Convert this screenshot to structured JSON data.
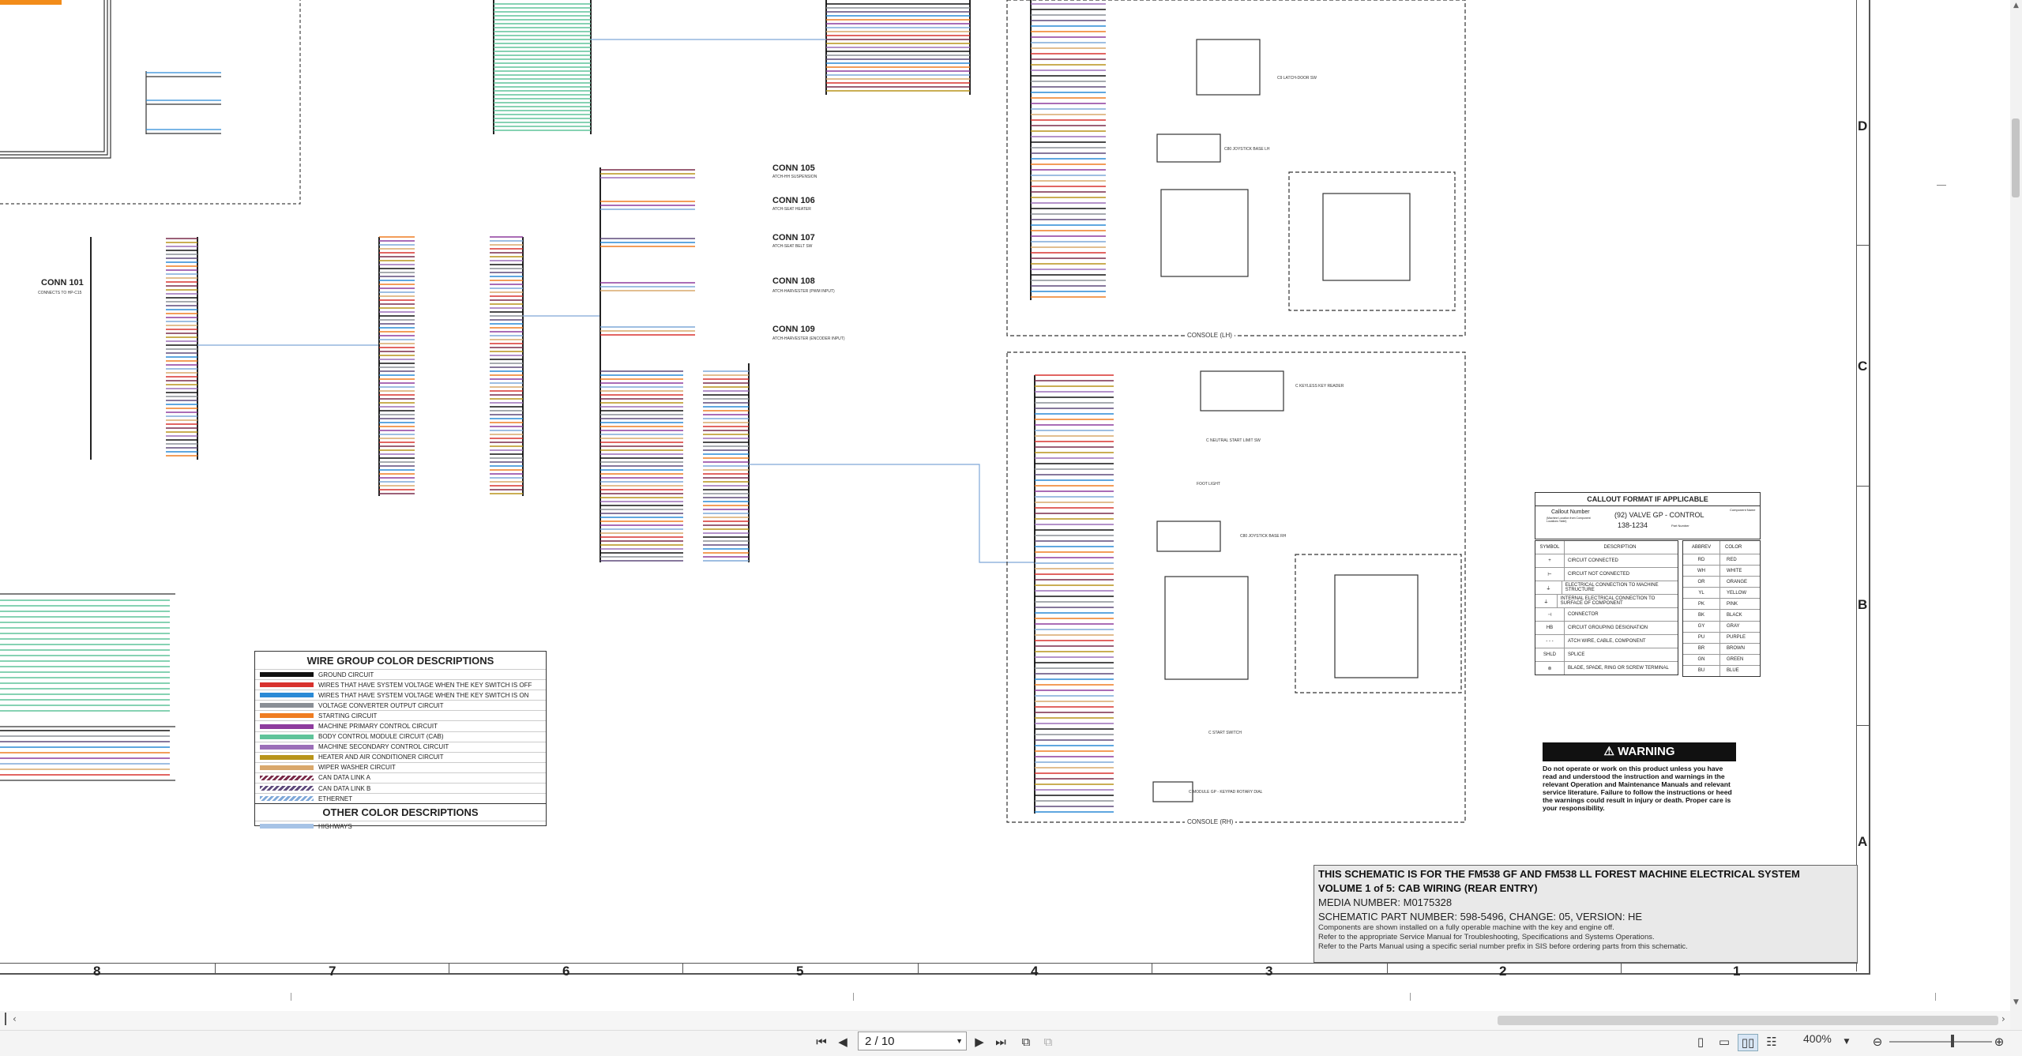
{
  "sheet": {
    "zone_letters": [
      "D",
      "C",
      "B",
      "A"
    ],
    "zone_numbers": [
      "8",
      "7",
      "6",
      "5",
      "4",
      "3",
      "2",
      "1"
    ],
    "connectors": [
      {
        "name": "CONN 101",
        "sub": "CONNECTS TO HP-C15"
      },
      {
        "name": "CONN 105",
        "sub": "ATCH-HH SUSPENSION"
      },
      {
        "name": "CONN 106",
        "sub": "ATCH-SEAT HEATER"
      },
      {
        "name": "CONN 107",
        "sub": "ATCH-SEAT BELT SW"
      },
      {
        "name": "CONN 108",
        "sub": "ATCH-HARVESTER (PWM INPUT)"
      },
      {
        "name": "CONN 109",
        "sub": "ATCH-HARVESTER (ENCODER INPUT)"
      }
    ],
    "console_lh": "CONSOLE (LH)",
    "console_rh": "CONSOLE (RH)",
    "components": [
      "C9 LATCH-DOOR SW",
      "C80 JOYSTICK BASE LH",
      "C NEUTRAL START LIMIT SW",
      "FOOT LIGHT",
      "C80 JOYSTICK BASE RH",
      "C START SWITCH",
      "C MODULE GP - KEYPAD ROTARY DIAL",
      "C KEYLESS KEY READER"
    ]
  },
  "wire_legend": {
    "title": "WIRE GROUP COLOR DESCRIPTIONS",
    "rows": [
      {
        "color": "#111111",
        "label": "GROUND CIRCUIT"
      },
      {
        "color": "#d8322e",
        "label": "WIRES THAT HAVE SYSTEM VOLTAGE WHEN THE KEY SWITCH IS OFF"
      },
      {
        "color": "#2a8ad6",
        "label": "WIRES THAT HAVE SYSTEM VOLTAGE WHEN THE KEY SWITCH IS ON"
      },
      {
        "color": "#8a8f96",
        "label": "VOLTAGE CONVERTER OUTPUT CIRCUIT"
      },
      {
        "color": "#ef7d22",
        "label": "STARTING CIRCUIT"
      },
      {
        "color": "#8e3c9e",
        "label": "MACHINE PRIMARY CONTROL CIRCUIT"
      },
      {
        "color": "#5fc39a",
        "label": "BODY CONTROL MODULE CIRCUIT (CAB)"
      },
      {
        "color": "#9b6fb8",
        "label": "MACHINE SECONDARY CONTROL CIRCUIT"
      },
      {
        "color": "#b8941a",
        "label": "HEATER AND AIR CONDITIONER CIRCUIT"
      },
      {
        "color": "#d9a86c",
        "label": "WIPER WASHER CIRCUIT"
      },
      {
        "color": "#7a2b4a",
        "label": "CAN DATA LINK A"
      },
      {
        "color": "#5e4a7c",
        "label": "CAN DATA LINK B"
      },
      {
        "color": "#7fa8d8",
        "label": "ETHERNET"
      }
    ],
    "other_title": "OTHER COLOR DESCRIPTIONS",
    "other_rows": [
      {
        "color": "#a6c3e6",
        "label": "HIGHWAYS"
      }
    ]
  },
  "callout": {
    "title": "CALLOUT FORMAT IF APPLICABLE",
    "line1": "Callout Number",
    "line1b": "(Machine Location from Component Locations Table)",
    "example": "(92) VALVE GP - CONTROL",
    "part": "138-1234",
    "part_label": "Part Number",
    "name_label": "Component Name"
  },
  "symbols": {
    "headers": [
      "SYMBOL",
      "DESCRIPTION"
    ],
    "rows": [
      {
        "sym": "+",
        "desc": "CIRCUIT CONNECTED"
      },
      {
        "sym": "⊢",
        "desc": "CIRCUIT NOT CONNECTED"
      },
      {
        "sym": "⏚",
        "desc": "ELECTRICAL CONNECTION TO MACHINE STRUCTURE"
      },
      {
        "sym": "⏚",
        "desc": "INTERNAL ELECTRICAL CONNECTION TO SURFACE OF COMPONENT"
      },
      {
        "sym": "⊣",
        "desc": "CONNECTOR"
      },
      {
        "sym": "HB",
        "desc": "CIRCUIT GROUPING DESIGNATION"
      },
      {
        "sym": "- - -",
        "desc": "ATCH WIRE, CABLE, COMPONENT"
      },
      {
        "sym": "SHLD",
        "desc": "SPLICE"
      },
      {
        "sym": "⊚",
        "desc": "BLADE, SPADE, RING OR SCREW TERMINAL"
      }
    ]
  },
  "abbrev": {
    "headers": [
      "ABBREV",
      "COLOR"
    ],
    "rows": [
      {
        "a": "RD",
        "c": "RED"
      },
      {
        "a": "WH",
        "c": "WHITE"
      },
      {
        "a": "OR",
        "c": "ORANGE"
      },
      {
        "a": "YL",
        "c": "YELLOW"
      },
      {
        "a": "PK",
        "c": "PINK"
      },
      {
        "a": "BK",
        "c": "BLACK"
      },
      {
        "a": "GY",
        "c": "GRAY"
      },
      {
        "a": "PU",
        "c": "PURPLE"
      },
      {
        "a": "BR",
        "c": "BROWN"
      },
      {
        "a": "GN",
        "c": "GREEN"
      },
      {
        "a": "BU",
        "c": "BLUE"
      }
    ]
  },
  "warning": {
    "title": "WARNING",
    "text": "Do not operate or work on this product unless you have read and understood the instruction and warnings in the relevant Operation and Maintenance Manuals and relevant service literature. Failure to follow the instructions or heed the warnings could result in injury or death. Proper care is your responsibility."
  },
  "titleblock": {
    "line1": "THIS SCHEMATIC IS FOR THE FM538 GF AND FM538 LL FOREST MACHINE ELECTRICAL SYSTEM",
    "line2": "VOLUME 1 of 5: CAB WIRING (REAR ENTRY)",
    "line3": "MEDIA NUMBER: M0175328",
    "line4": "SCHEMATIC PART NUMBER: 598-5496, CHANGE: 05, VERSION: HE",
    "line5": "Components are shown installed on a fully operable machine with the key and engine off.",
    "line6": "Refer to the appropriate Service Manual for Troubleshooting, Specifications and Systems Operations.",
    "line7": "Refer to the Parts Manual using a specific serial number prefix in SIS before ordering parts from this schematic."
  },
  "toolbar": {
    "page_value": "2 / 10",
    "zoom": "400%"
  }
}
